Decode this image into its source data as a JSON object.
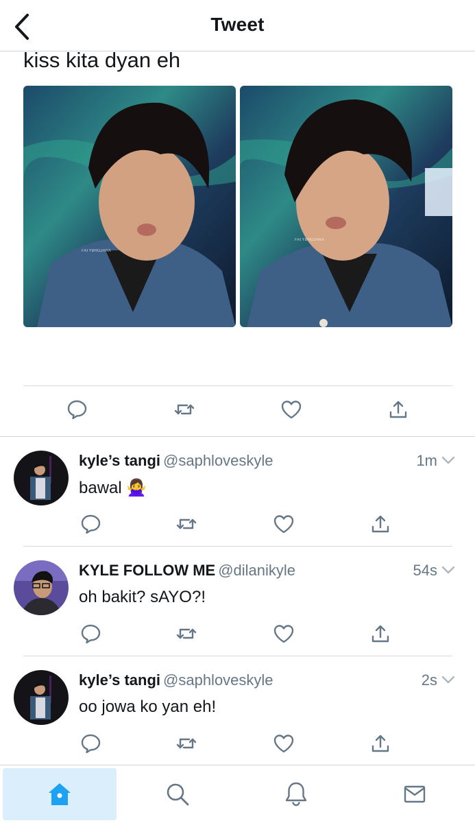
{
  "header": {
    "title": "Tweet",
    "back_icon": "chevron-left-icon"
  },
  "main_tweet": {
    "text": "kiss kita dyan eh",
    "images": [
      {
        "watermark": "FATYBHOJARA"
      },
      {
        "watermark": "FATYBHOJARA"
      }
    ],
    "actions": [
      "reply-icon",
      "retweet-icon",
      "like-icon",
      "share-icon"
    ]
  },
  "replies": [
    {
      "name": "kyle’s tangi",
      "handle": "@saphloveskyle",
      "time": "1m",
      "text": "bawal 🙅‍♀️"
    },
    {
      "name": "KYLE FOLLOW ME",
      "handle": "@dilanikyle",
      "time": "54s",
      "text": "oh bakit? sAYO?!"
    },
    {
      "name": "kyle’s tangi",
      "handle": "@saphloveskyle",
      "time": "2s",
      "text": "oo jowa ko yan eh!"
    }
  ],
  "tabbar": {
    "tabs": [
      {
        "icon": "home-icon",
        "active": true
      },
      {
        "icon": "search-icon",
        "active": false
      },
      {
        "icon": "notifications-icon",
        "active": false
      },
      {
        "icon": "messages-icon",
        "active": false
      }
    ]
  },
  "colors": {
    "accent": "#1da1f2",
    "icon_gray": "#657786",
    "divider": "#d6dbe0",
    "active_tab_bg": "#dbeefc"
  }
}
